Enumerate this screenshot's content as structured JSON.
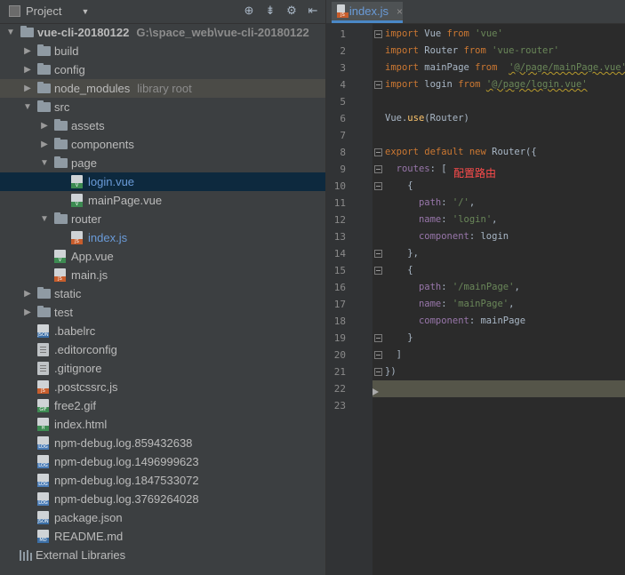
{
  "project_panel": {
    "title": "Project",
    "tree": [
      {
        "label": "vue-cli-20180122",
        "hint": "G:\\space_web\\vue-cli-20180122",
        "kind": "folder",
        "depth": 0,
        "expanded": true
      },
      {
        "label": "build",
        "kind": "folder",
        "depth": 1,
        "expanded": false
      },
      {
        "label": "config",
        "kind": "folder",
        "depth": 1,
        "expanded": false
      },
      {
        "label": "node_modules",
        "hint": "library root",
        "kind": "folder",
        "depth": 1,
        "expanded": false
      },
      {
        "label": "src",
        "kind": "folder",
        "depth": 1,
        "expanded": true
      },
      {
        "label": "assets",
        "kind": "folder",
        "depth": 2,
        "expanded": false
      },
      {
        "label": "components",
        "kind": "folder",
        "depth": 2,
        "expanded": false
      },
      {
        "label": "page",
        "kind": "folder",
        "depth": 2,
        "expanded": true
      },
      {
        "label": "login.vue",
        "kind": "vue",
        "depth": 3,
        "selected": true
      },
      {
        "label": "mainPage.vue",
        "kind": "vue",
        "depth": 3
      },
      {
        "label": "router",
        "kind": "folder",
        "depth": 2,
        "expanded": true
      },
      {
        "label": "index.js",
        "kind": "js",
        "depth": 3,
        "open": true
      },
      {
        "label": "App.vue",
        "kind": "vue",
        "depth": 2
      },
      {
        "label": "main.js",
        "kind": "js",
        "depth": 2
      },
      {
        "label": "static",
        "kind": "folder",
        "depth": 1,
        "expanded": false
      },
      {
        "label": "test",
        "kind": "folder",
        "depth": 1,
        "expanded": false
      },
      {
        "label": ".babelrc",
        "kind": "json",
        "depth": 1
      },
      {
        "label": ".editorconfig",
        "kind": "txt",
        "depth": 1
      },
      {
        "label": ".gitignore",
        "kind": "txt",
        "depth": 1
      },
      {
        "label": ".postcssrc.js",
        "kind": "js",
        "depth": 1
      },
      {
        "label": "free2.gif",
        "kind": "gif",
        "depth": 1
      },
      {
        "label": "index.html",
        "kind": "html",
        "depth": 1
      },
      {
        "label": "npm-debug.log.859432638",
        "kind": "log",
        "depth": 1
      },
      {
        "label": "npm-debug.log.1496999623",
        "kind": "log",
        "depth": 1
      },
      {
        "label": "npm-debug.log.1847533072",
        "kind": "log",
        "depth": 1
      },
      {
        "label": "npm-debug.log.3769264028",
        "kind": "log",
        "depth": 1
      },
      {
        "label": "package.json",
        "kind": "json",
        "depth": 1
      },
      {
        "label": "README.md",
        "kind": "md",
        "depth": 1
      },
      {
        "label": "External Libraries",
        "kind": "lib",
        "depth": 0
      }
    ]
  },
  "editor": {
    "tab": {
      "label": "index.js",
      "badge": "JS"
    },
    "line_numbers": [
      "1",
      "2",
      "3",
      "4",
      "5",
      "6",
      "7",
      "8",
      "9",
      "10",
      "11",
      "12",
      "13",
      "14",
      "15",
      "16",
      "17",
      "18",
      "19",
      "20",
      "21",
      "22",
      "23"
    ],
    "annotation": "配置路由",
    "lines": [
      [
        {
          "t": "import",
          "c": "kw"
        },
        {
          "t": " Vue "
        },
        {
          "t": "from",
          "c": "kw"
        },
        {
          "t": " "
        },
        {
          "t": "'vue'",
          "c": "str"
        }
      ],
      [
        {
          "t": "import",
          "c": "kw"
        },
        {
          "t": " Router "
        },
        {
          "t": "from",
          "c": "kw"
        },
        {
          "t": " "
        },
        {
          "t": "'vue-router'",
          "c": "str"
        }
      ],
      [
        {
          "t": "import",
          "c": "kw"
        },
        {
          "t": " mainPage "
        },
        {
          "t": "from",
          "c": "kw"
        },
        {
          "t": "  "
        },
        {
          "t": "'@/page/mainPage.vue'",
          "c": "str ul"
        }
      ],
      [
        {
          "t": "import",
          "c": "kw"
        },
        {
          "t": " login "
        },
        {
          "t": "from",
          "c": "kw"
        },
        {
          "t": " "
        },
        {
          "t": "'@/page/login.vue'",
          "c": "str ul"
        }
      ],
      [],
      [
        {
          "t": "Vue."
        },
        {
          "t": "use",
          "c": "fn"
        },
        {
          "t": "(Router)"
        }
      ],
      [],
      [
        {
          "t": "export default new",
          "c": "kw"
        },
        {
          "t": " Router({"
        }
      ],
      [
        {
          "t": "  "
        },
        {
          "t": "routes",
          "c": "prop"
        },
        {
          "t": ": ["
        }
      ],
      [
        {
          "t": "    {"
        }
      ],
      [
        {
          "t": "      "
        },
        {
          "t": "path",
          "c": "prop"
        },
        {
          "t": ": "
        },
        {
          "t": "'/'",
          "c": "str"
        },
        {
          "t": ","
        }
      ],
      [
        {
          "t": "      "
        },
        {
          "t": "name",
          "c": "prop"
        },
        {
          "t": ": "
        },
        {
          "t": "'login'",
          "c": "str"
        },
        {
          "t": ","
        }
      ],
      [
        {
          "t": "      "
        },
        {
          "t": "component",
          "c": "prop"
        },
        {
          "t": ": login"
        }
      ],
      [
        {
          "t": "    },"
        }
      ],
      [
        {
          "t": "    {"
        }
      ],
      [
        {
          "t": "      "
        },
        {
          "t": "path",
          "c": "prop"
        },
        {
          "t": ": "
        },
        {
          "t": "'/mainPage'",
          "c": "str"
        },
        {
          "t": ","
        }
      ],
      [
        {
          "t": "      "
        },
        {
          "t": "name",
          "c": "prop"
        },
        {
          "t": ": "
        },
        {
          "t": "'mainPage'",
          "c": "str"
        },
        {
          "t": ","
        }
      ],
      [
        {
          "t": "      "
        },
        {
          "t": "component",
          "c": "prop"
        },
        {
          "t": ": mainPage"
        }
      ],
      [
        {
          "t": "    }"
        }
      ],
      [
        {
          "t": "  ]"
        }
      ],
      [
        {
          "t": "})"
        }
      ],
      [],
      []
    ]
  }
}
